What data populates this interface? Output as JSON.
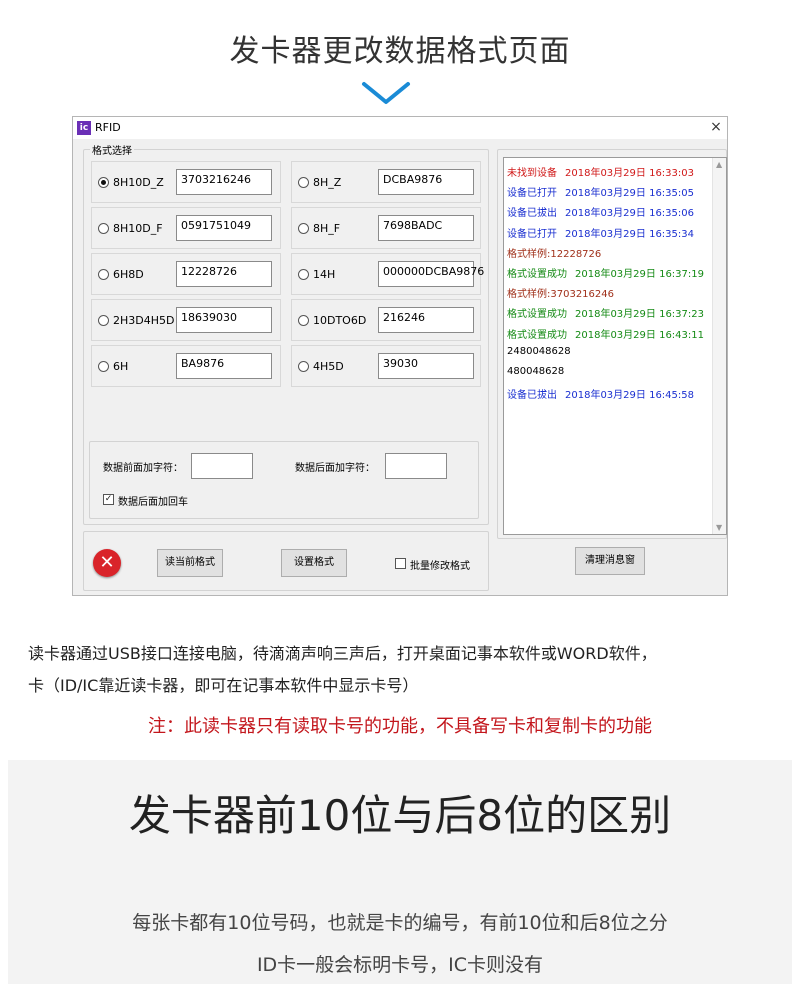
{
  "header": {
    "title": "发卡器更改数据格式页面",
    "chevron_icon": "chevron-down-icon",
    "accent_color": "#1a8bd6"
  },
  "window": {
    "app_icon_letter": "ic",
    "title": "RFID",
    "close_label": "×",
    "format_group_label": "格式选择",
    "formats": [
      {
        "label": "8H10D_Z",
        "value": "3703216246",
        "selected": true
      },
      {
        "label": "8H_Z",
        "value": "DCBA9876",
        "selected": false
      },
      {
        "label": "8H10D_F",
        "value": "0591751049",
        "selected": false
      },
      {
        "label": "8H_F",
        "value": "7698BADC",
        "selected": false
      },
      {
        "label": "6H8D",
        "value": "12228726",
        "selected": false
      },
      {
        "label": "14H",
        "value": "000000DCBA9876",
        "selected": false
      },
      {
        "label": "2H3D4H5D",
        "value": "18639030",
        "selected": false
      },
      {
        "label": "10DTO6D",
        "value": "216246",
        "selected": false
      },
      {
        "label": "6H",
        "value": "BA9876",
        "selected": false
      },
      {
        "label": "4H5D",
        "value": "39030",
        "selected": false
      }
    ],
    "prefix_label": "数据前面加字符：",
    "suffix_label": "数据后面加字符：",
    "prefix_value": "",
    "suffix_value": "",
    "append_cr_label": "数据后面加回车",
    "append_cr_checked": true,
    "read_btn": "读当前格式",
    "set_btn": "设置格式",
    "batch_label": "批量修改格式",
    "batch_checked": false,
    "clear_btn": "清理消息窗",
    "error_icon": "close-circle-icon",
    "log": [
      {
        "text": "未找到设备",
        "time": "2018年03月29日 16:33:03",
        "color": "#d01818"
      },
      {
        "text": "设备已打开",
        "time": "2018年03月29日 16:35:05",
        "color": "#1a2fd0"
      },
      {
        "text": "设备已拔出",
        "time": "2018年03月29日 16:35:06",
        "color": "#1a2fd0"
      },
      {
        "text": "设备已打开",
        "time": "2018年03月29日 16:35:34",
        "color": "#1a2fd0"
      },
      {
        "text": "格式样例:12228726",
        "time": "",
        "color": "#a0301a"
      },
      {
        "text": "格式设置成功",
        "time": "2018年03月29日 16:37:19",
        "color": "#148a14"
      },
      {
        "text": "格式样例:3703216246",
        "time": "",
        "color": "#a0301a"
      },
      {
        "text": "格式设置成功",
        "time": "2018年03月29日 16:37:23",
        "color": "#148a14"
      },
      {
        "text": "格式设置成功",
        "time": "2018年03月29日 16:43:11",
        "color": "#148a14"
      },
      {
        "text": "2480048628",
        "time": "",
        "color": "#000000"
      },
      {
        "text": "480048628",
        "time": "",
        "color": "#000000"
      },
      {
        "text": "设备已拔出",
        "time": "2018年03月29日 16:45:58",
        "color": "#1a2fd0"
      }
    ]
  },
  "intro": {
    "line1": "读卡器通过USB接口连接电脑，待滴滴声响三声后，打开桌面记事本软件或WORD软件，",
    "line2": "卡（ID/IC靠近读卡器，即可在记事本软件中显示卡号）",
    "note": "注：此读卡器只有读取卡号的功能，不具备写卡和复制卡的功能"
  },
  "section": {
    "title": "发卡器前10位与后8位的区别",
    "line1": "每张卡都有10位号码，也就是卡的编号，有前10位和后8位之分",
    "line2": "ID卡一般会标明卡号，IC卡则没有"
  }
}
